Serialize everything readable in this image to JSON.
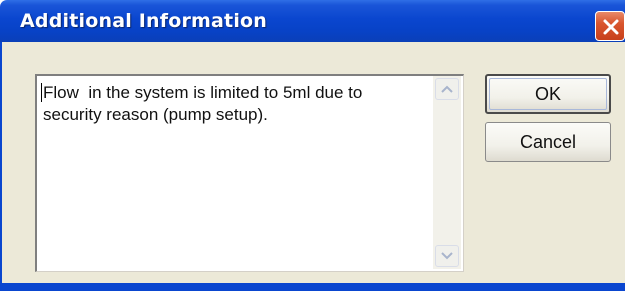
{
  "window": {
    "title": "Additional Information"
  },
  "message": {
    "text": "Flow  in the system is limited to 5ml due to\nsecurity reason (pump setup)."
  },
  "buttons": {
    "ok_label": "OK",
    "cancel_label": "Cancel"
  },
  "colors": {
    "titlebar": "#0a46cf",
    "close_button": "#d9562f",
    "client_bg": "#ece9d8"
  },
  "icons": {
    "close": "close-icon",
    "scroll_up": "chevron-up-icon",
    "scroll_down": "chevron-down-icon"
  }
}
